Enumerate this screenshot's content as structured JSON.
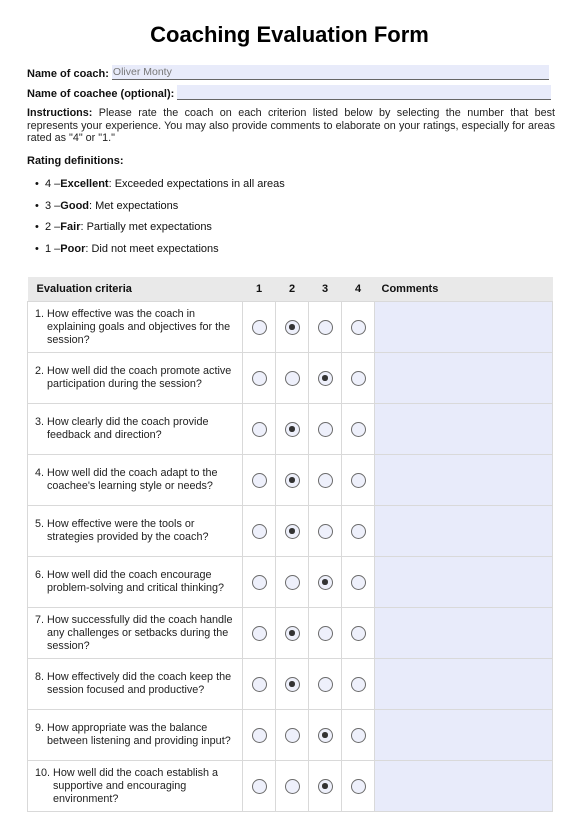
{
  "title": "Coaching Evaluation Form",
  "fields": {
    "coach": {
      "label": "Name of coach:",
      "value": "Oliver Monty"
    },
    "coachee": {
      "label": "Name of coachee (optional):",
      "value": ""
    }
  },
  "instructions": {
    "label": "Instructions:",
    "text": "Please rate the coach on each criterion listed below by selecting the number that best represents your experience. You may also provide comments to elaborate on your ratings, especially for areas rated as \"4\" or \"1.\""
  },
  "rating_definitions": {
    "heading": "Rating definitions:",
    "items": [
      {
        "num": "4 – ",
        "term": "Excellent",
        "desc": ": Exceeded expectations in all areas"
      },
      {
        "num": "3 – ",
        "term": "Good",
        "desc": ": Met expectations"
      },
      {
        "num": "2 – ",
        "term": "Fair",
        "desc": ": Partially met expectations"
      },
      {
        "num": "1 – ",
        "term": "Poor",
        "desc": ": Did not meet expectations"
      }
    ]
  },
  "table": {
    "headers": {
      "criteria": "Evaluation criteria",
      "r1": "1",
      "r2": "2",
      "r3": "3",
      "r4": "4",
      "comments": "Comments"
    },
    "rows": [
      {
        "num": "1.",
        "text": "How effective was the coach in explaining goals and objectives for the session?",
        "rating": 2,
        "comment": ""
      },
      {
        "num": "2.",
        "text": "How well did the coach promote active participation during the session?",
        "rating": 3,
        "comment": ""
      },
      {
        "num": "3.",
        "text": "How clearly did the coach provide feedback and direction?",
        "rating": 2,
        "comment": ""
      },
      {
        "num": "4.",
        "text": "How well did the coach adapt to the coachee's learning style or needs?",
        "rating": 2,
        "comment": ""
      },
      {
        "num": "5.",
        "text": "How effective were the tools or strategies provided by the coach?",
        "rating": 2,
        "comment": ""
      },
      {
        "num": "6.",
        "text": "How well did the coach encourage problem-solving and critical thinking?",
        "rating": 3,
        "comment": ""
      },
      {
        "num": "7.",
        "text": "How successfully did the coach handle any challenges or setbacks during the session?",
        "rating": 2,
        "comment": ""
      },
      {
        "num": "8.",
        "text": "How effectively did the coach keep the session focused and productive?",
        "rating": 2,
        "comment": ""
      },
      {
        "num": "9.",
        "text": "How appropriate was the balance between listening and providing input?",
        "rating": 3,
        "comment": ""
      },
      {
        "num": "10.",
        "text": "How well did the coach establish a supportive and encouraging environment?",
        "rating": 3,
        "comment": ""
      }
    ]
  }
}
